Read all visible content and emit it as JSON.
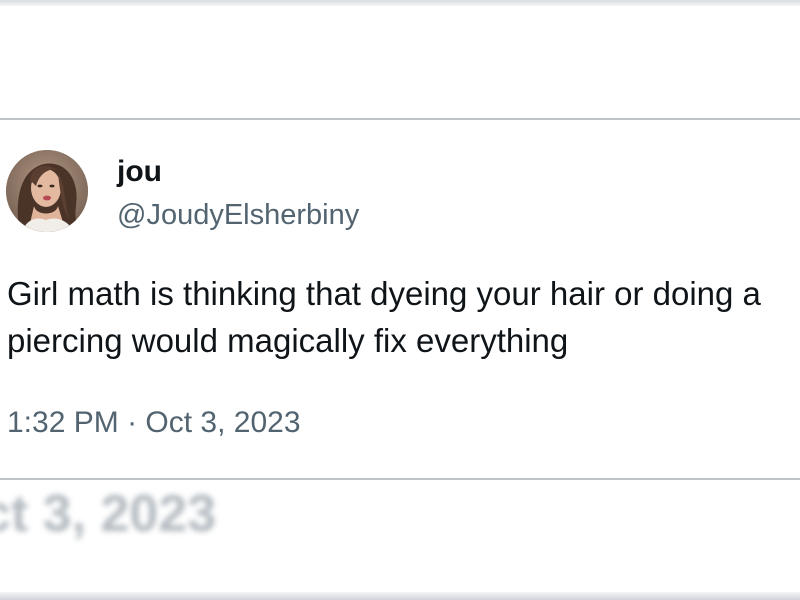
{
  "tweet": {
    "display_name": "jou",
    "handle": "@JoudyElsherbiny",
    "text_lines": [
      "Girl math is thinking that dyeing your hair or doing a",
      "piercing would magically fix everything"
    ],
    "time": "1:32 PM",
    "separator": "·",
    "date": "Oct 3, 2023"
  },
  "background_echo": {
    "date_fragment": "ct 3, 2023"
  },
  "colors": {
    "primary_text": "#0f1419",
    "secondary_text": "#536471",
    "divider": "#bfc4c9"
  }
}
